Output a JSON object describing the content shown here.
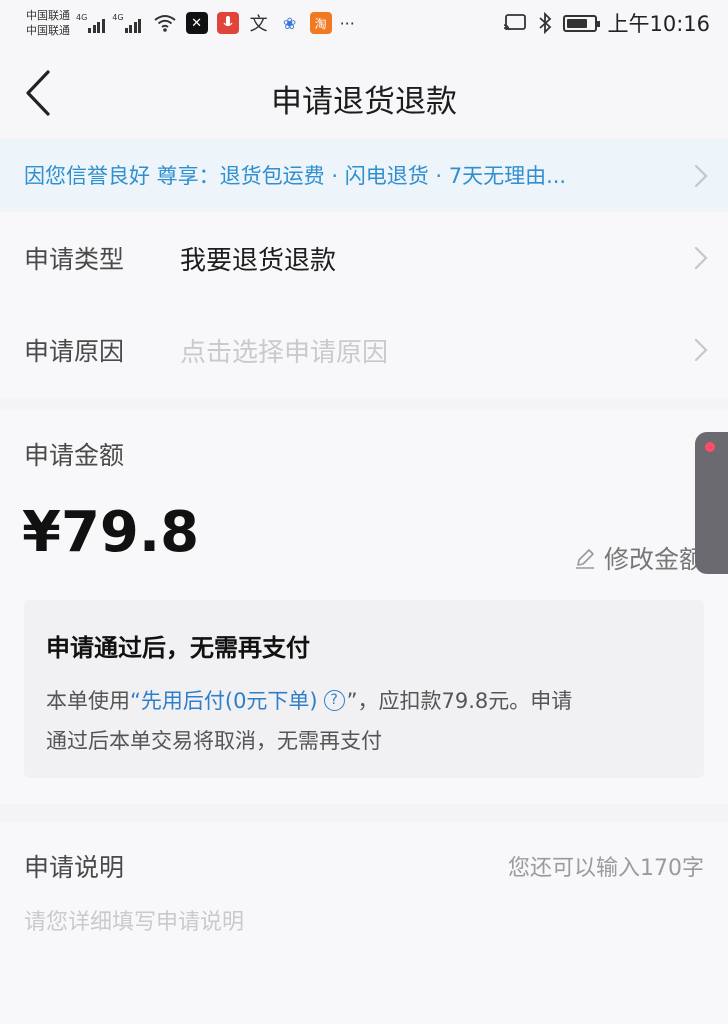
{
  "status_bar": {
    "carrier_1": "中国联通",
    "carrier_2": "中国联通",
    "network_tag_1": "4G",
    "network_tag_2": "4G",
    "time": "上午10:16",
    "battery_percent": 75
  },
  "nav": {
    "title": "申请退货退款"
  },
  "promo": {
    "text": "因您信誉良好 尊享：退货包运费 · 闪电退货 · 7天无理由..."
  },
  "form": {
    "type_label": "申请类型",
    "type_value": "我要退货退款",
    "reason_label": "申请原因",
    "reason_placeholder": "点击选择申请原因"
  },
  "amount": {
    "label": "申请金额",
    "value": "¥79.8",
    "edit_label": "修改金额"
  },
  "notice": {
    "title": "申请通过后，无需再支付",
    "body_prefix": "本单使用",
    "body_link": "“先用后付(0元下单)",
    "body_help_mark": "?",
    "body_suffix_line1": "”，应扣款79.8元。申请",
    "body_line2": "通过后本单交易将取消，无需再支付"
  },
  "description": {
    "label": "申请说明",
    "counter": "您还可以输入170字",
    "placeholder": "请您详细填写申请说明"
  },
  "colors": {
    "accent_blue": "#2f8fcf",
    "link_blue": "#2f7fc8",
    "placeholder_gray": "#c9c9cf",
    "page_bg": "#f4f4f6"
  }
}
